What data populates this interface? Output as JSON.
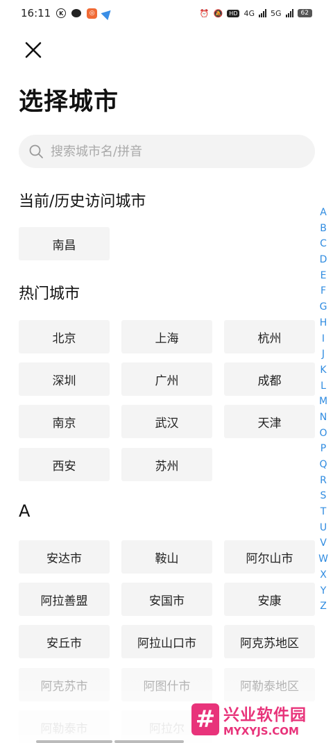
{
  "status_bar": {
    "time": "16:11",
    "network_a": "4G",
    "network_b": "5G",
    "hd": "HD",
    "battery": "62"
  },
  "header": {
    "title": "选择城市"
  },
  "search": {
    "placeholder": "搜索城市名/拼音"
  },
  "sections": {
    "recent_title": "当前/历史访问城市",
    "hot_title": "热门城市",
    "a_title": "A"
  },
  "recent_cities": [
    "南昌"
  ],
  "hot_cities": [
    "北京",
    "上海",
    "杭州",
    "深圳",
    "广州",
    "成都",
    "南京",
    "武汉",
    "天津",
    "西安",
    "苏州"
  ],
  "a_cities": [
    "安达市",
    "鞍山",
    "阿尔山市",
    "阿拉善盟",
    "安国市",
    "安康",
    "安丘市",
    "阿拉山口市",
    "阿克苏地区",
    "阿克苏市",
    "阿图什市",
    "阿勒泰地区",
    "阿勒泰市",
    "阿拉尔"
  ],
  "index_letters": [
    "A",
    "B",
    "C",
    "D",
    "E",
    "F",
    "G",
    "H",
    "I",
    "J",
    "K",
    "L",
    "M",
    "N",
    "O",
    "P",
    "Q",
    "R",
    "S",
    "T",
    "U",
    "V",
    "W",
    "X",
    "Y",
    "Z"
  ],
  "watermark": {
    "logo_glyph": "#",
    "name": "兴业软件园",
    "url": "MYXYJS.COM"
  },
  "colors": {
    "index_accent": "#2f8be0",
    "watermark": "#e8337a"
  }
}
